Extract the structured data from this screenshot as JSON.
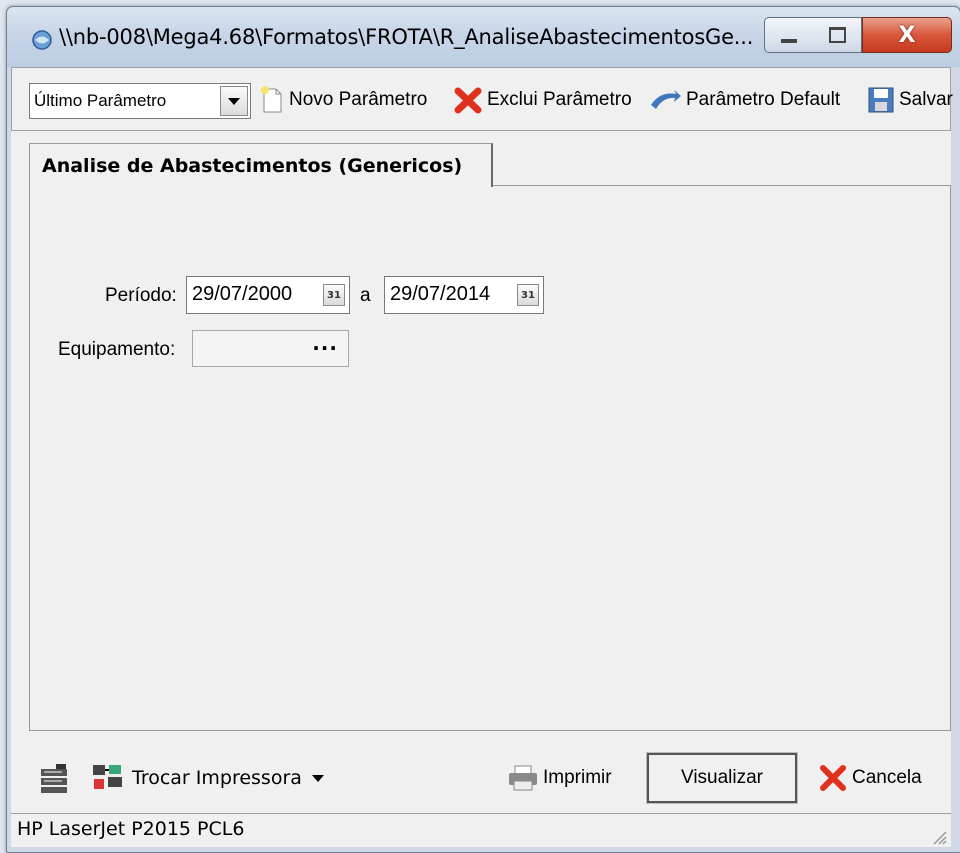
{
  "window": {
    "title": "\\\\nb-008\\Mega4.68\\Formatos\\FROTA\\R_AnaliseAbastecimentosGe...",
    "close_label": "X"
  },
  "toolbar": {
    "param_select": "Último Parâmetro",
    "novo": "Novo Parâmetro",
    "exclui": "Exclui Parâmetro",
    "default": "Parâmetro Default",
    "salvar": "Salvar"
  },
  "tab": {
    "label": "Analise de Abastecimentos (Genericos)"
  },
  "form": {
    "periodo_label": "Período:",
    "date_from": "29/07/2000",
    "date_sep": "a",
    "date_to": "29/07/2014",
    "equipamento_label": "Equipamento:",
    "equipamento_value": "",
    "equipamento_button": "···"
  },
  "bottom": {
    "trocar": "Trocar Impressora",
    "imprimir": "Imprimir",
    "visualizar": "Visualizar",
    "cancela": "Cancela"
  },
  "status": {
    "printer": "HP LaserJet P2015 PCL6"
  },
  "colors": {
    "close_red": "#d9573c",
    "exclui_red": "#e0301e"
  }
}
